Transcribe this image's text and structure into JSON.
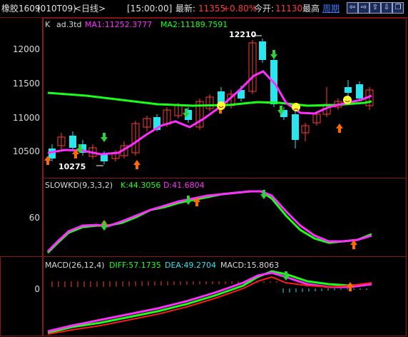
{
  "header": {
    "title": "橡胶1609",
    "code": "(010T09)",
    "period": "<日线>",
    "time": "[15:00:00]",
    "latest_label": "最新:",
    "latest_value": "11355",
    "change_pct": "+0.80%",
    "open_label": "今开:",
    "open_value": "11130",
    "high_label": "最高",
    "week_link": "周期"
  },
  "nav_buttons": [
    {
      "name": "nav-back-icon",
      "glyph": "⇦"
    },
    {
      "name": "nav-forward-icon",
      "glyph": "⇨"
    },
    {
      "name": "nav-up-icon",
      "glyph": "⇧"
    },
    {
      "name": "nav-down-icon",
      "glyph": "⇩"
    },
    {
      "name": "nav-restore-icon",
      "glyph": "❐"
    }
  ],
  "main_panel": {
    "prefix": "K",
    "indicator": "ad.3td",
    "ma1_label": "MA1:11252.3777",
    "ma2_label": "MA2:11189.7591",
    "y_ticks": [
      "12000",
      "11500",
      "11000",
      "10500"
    ],
    "annotation_high": "12210",
    "annotation_low": "10275"
  },
  "kd_panel": {
    "name": "SLOWKD(9,3,3,2)",
    "k_label": "K:44.3056",
    "d_label": "D:41.6804",
    "y_ticks": [
      "60"
    ]
  },
  "macd_panel": {
    "name": "MACD(26,12,4)",
    "diff_label": "DIFF:57.1735",
    "dea_label": "DEA:49.2704",
    "macd_label": "MACD:15.8063",
    "y_ticks": [
      "0"
    ]
  },
  "colors": {
    "up": "#ff3b3b",
    "down": "#28e6f0",
    "ma1": "#ff2dff",
    "ma2": "#19ff19",
    "grid_border": "#8a1818",
    "arrow_up": "#ff6a00",
    "arrow_down": "#2fd23a",
    "smile": "#ffff33"
  }
}
